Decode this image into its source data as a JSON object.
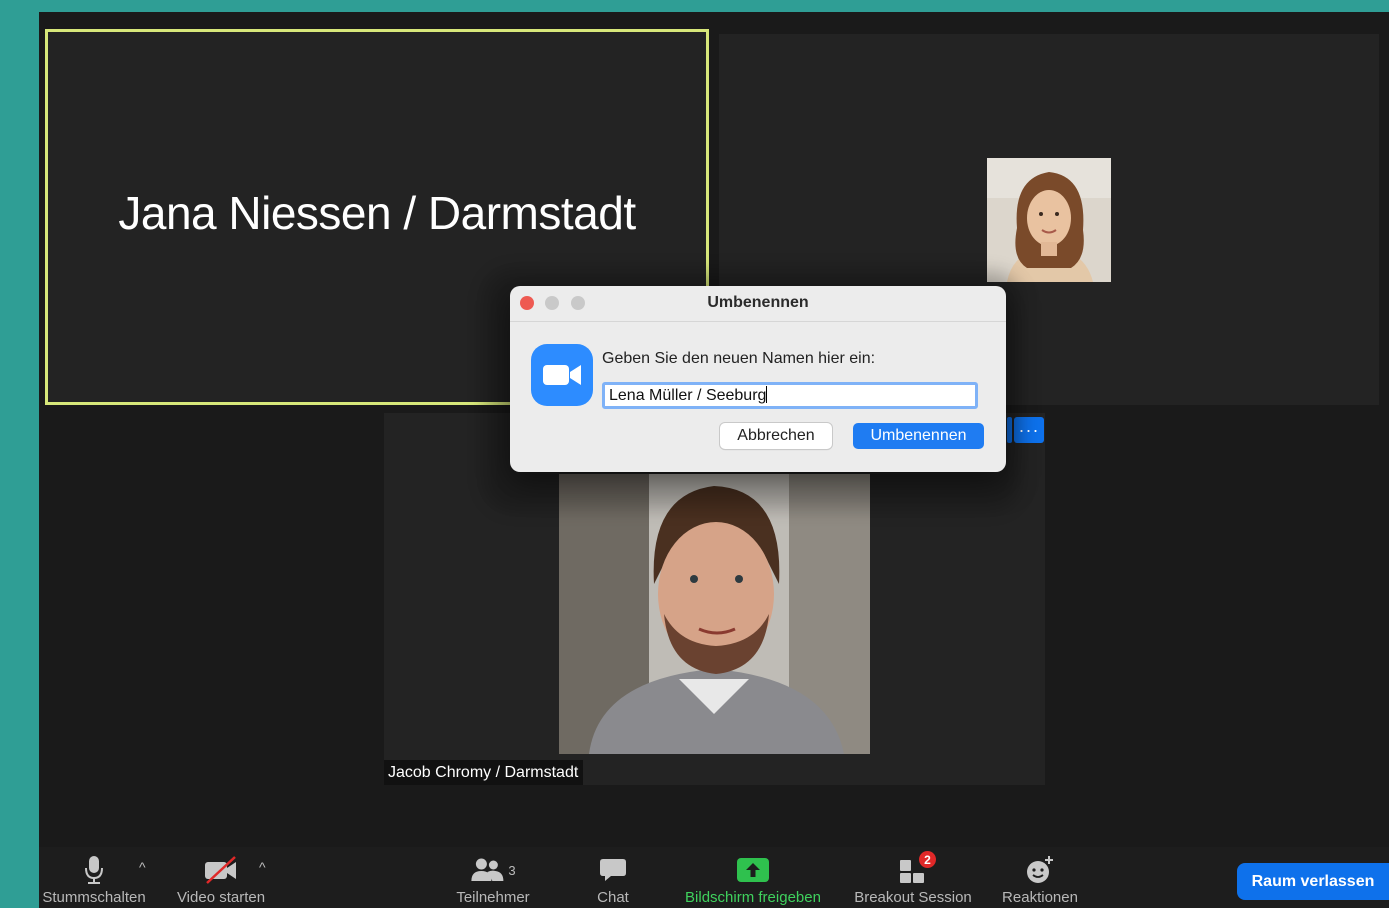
{
  "tiles": {
    "active_speaker_name": "Jana Niessen / Darmstadt",
    "jacob_name_tag": "Jacob Chromy / Darmstadt",
    "more_label": "···"
  },
  "dialog": {
    "title": "Umbenennen",
    "prompt": "Geben Sie den neuen Namen hier ein:",
    "input_value": "Lena Müller / Seeburg",
    "cancel_label": "Abbrechen",
    "confirm_label": "Umbenennen"
  },
  "toolbar": {
    "mute_label": "Stummschalten",
    "video_label": "Video starten",
    "participants_label": "Teilnehmer",
    "participants_count": "3",
    "chat_label": "Chat",
    "share_label": "Bildschirm freigeben",
    "breakout_label": "Breakout Session",
    "breakout_badge": "2",
    "reactions_label": "Reaktionen",
    "leave_label": "Raum verlassen"
  },
  "colors": {
    "accent_blue": "#0e71eb",
    "active_speaker_border": "#d7e77a",
    "share_green": "#3fd15d",
    "badge_red": "#e02828"
  }
}
